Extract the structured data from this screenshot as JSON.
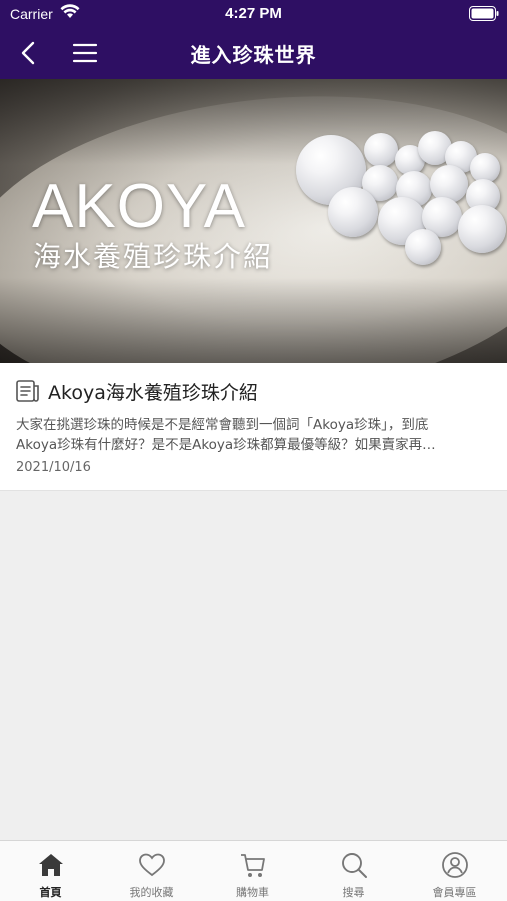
{
  "status_bar": {
    "carrier": "Carrier",
    "time": "4:27 PM"
  },
  "header": {
    "title": "進入珍珠世界",
    "back_icon": "chevron-left-icon",
    "menu_icon": "hamburger-menu-icon",
    "background": "#2e0f63"
  },
  "hero": {
    "title": "AKOYA",
    "subtitle": "海水養殖珍珠介紹"
  },
  "articles": [
    {
      "title": "Akoya海水養殖珍珠介紹",
      "excerpt_line1": "大家在挑選珍珠的時候是不是經常會聽到一個詞「Akoya珍珠」，到底",
      "excerpt_line2": "Akoya珍珠有什麼好？是不是Akoya珍珠都算最優等級？如果賣家再…",
      "date": "2021/10/16",
      "icon": "article-icon"
    }
  ],
  "tabbar": {
    "items": [
      {
        "label": "首頁",
        "icon": "home-icon",
        "active": true
      },
      {
        "label": "我的收藏",
        "icon": "heart-icon",
        "active": false
      },
      {
        "label": "購物車",
        "icon": "cart-icon",
        "active": false
      },
      {
        "label": "搜尋",
        "icon": "search-icon",
        "active": false
      },
      {
        "label": "會員專區",
        "icon": "user-icon",
        "active": false
      }
    ]
  }
}
